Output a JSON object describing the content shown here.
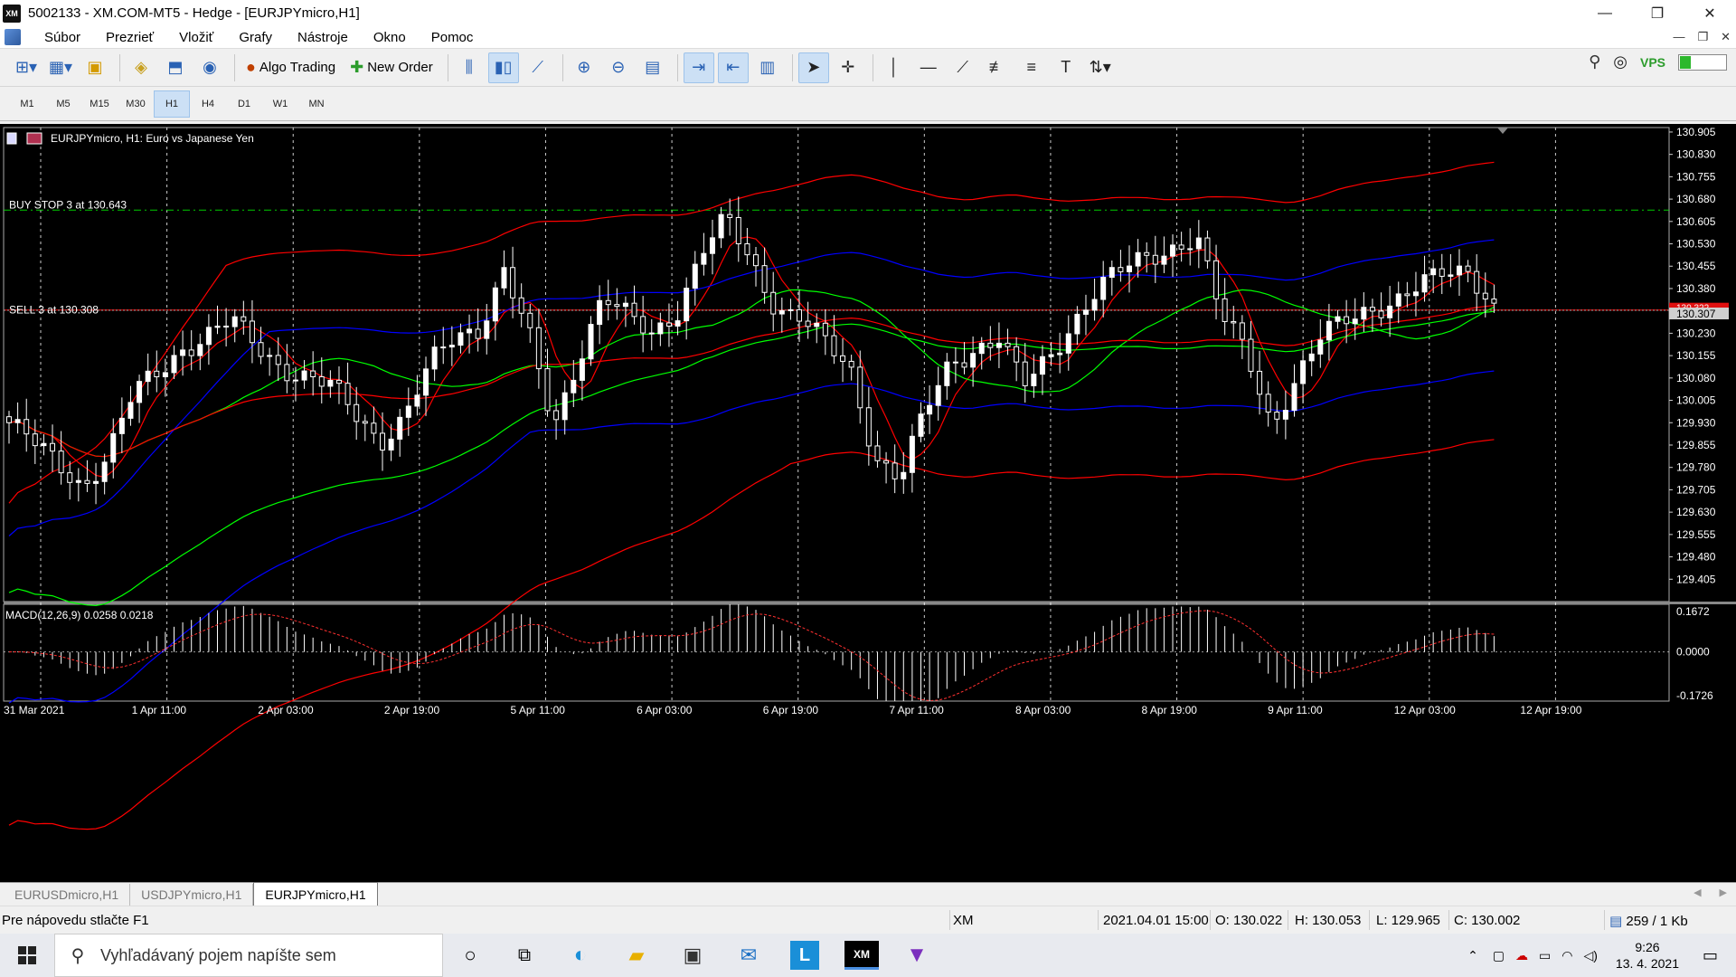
{
  "window": {
    "title": "5002133 - XM.COM-MT5 - Hedge - [EURJPYmicro,H1]",
    "logo_text": "XM",
    "controls": [
      "—",
      "❐",
      "✕"
    ]
  },
  "menu": {
    "items": [
      "Súbor",
      "Prezrieť",
      "Vložiť",
      "Grafy",
      "Nástroje",
      "Okno",
      "Pomoc"
    ],
    "mdi_controls": [
      "—",
      "❐",
      "✕"
    ]
  },
  "toolbar": {
    "algo_trading_label": "Algo Trading",
    "new_order_label": "New Order"
  },
  "timeframes": {
    "items": [
      "M1",
      "M5",
      "M15",
      "M30",
      "H1",
      "H4",
      "D1",
      "W1",
      "MN"
    ],
    "active": "H1"
  },
  "chart": {
    "header": "EURJPYmicro, H1:  Euro vs Japanese Yen",
    "buy_stop_label": "BUY STOP 3 at 130.643",
    "sell_label": "SELL 3 at 130.308",
    "bid_price": "130.307",
    "ask_price": "130.322",
    "macd_label": "MACD(12,26,9) 0.0258 0.0218",
    "price_ticks": [
      "130.905",
      "130.830",
      "130.755",
      "130.680",
      "130.605",
      "130.530",
      "130.455",
      "130.380",
      "130.230",
      "130.155",
      "130.080",
      "130.005",
      "129.930",
      "129.855",
      "129.780",
      "129.705",
      "129.630",
      "129.555",
      "129.480",
      "129.405"
    ],
    "macd_ticks": [
      "0.1672",
      "0.0000",
      "-0.1726"
    ],
    "time_ticks": [
      "31 Mar 2021",
      "1 Apr 11:00",
      "2 Apr 03:00",
      "2 Apr 19:00",
      "5 Apr 11:00",
      "6 Apr 03:00",
      "6 Apr 19:00",
      "7 Apr 11:00",
      "8 Apr 03:00",
      "8 Apr 19:00",
      "9 Apr 11:00",
      "12 Apr 03:00",
      "12 Apr 19:00"
    ],
    "colors": {
      "candle": "#ffffff",
      "ma_fast": "#ff0000",
      "ma_slow": "#00ff00",
      "bands_outer": "#ff0000",
      "bands_mid": "#0000ff",
      "order_line": "#ff0000",
      "pending_line": "#00ff00"
    }
  },
  "chart_data": {
    "type": "candlestick",
    "symbol": "EURJPYmicro",
    "timeframe": "H1",
    "ylim": [
      129.33,
      130.92
    ],
    "x_range": [
      "31 Mar 2021",
      "13 Apr 2021"
    ],
    "orders": [
      {
        "label": "BUY STOP 3 at 130.643",
        "price": 130.643
      },
      {
        "label": "SELL 3 at 130.308",
        "price": 130.308
      }
    ],
    "current_bid": 130.307,
    "current_ask": 130.322,
    "macd": {
      "params": "12,26,9",
      "main": 0.0258,
      "signal": 0.0218,
      "ylim": [
        -0.1726,
        0.1672
      ]
    },
    "close_path": [
      129.93,
      129.86,
      129.79,
      129.72,
      129.82,
      130.02,
      130.1,
      130.18,
      130.22,
      130.27,
      130.19,
      130.12,
      130.08,
      130.05,
      129.96,
      129.87,
      129.95,
      130.12,
      130.22,
      130.25,
      130.44,
      130.22,
      129.91,
      130.15,
      130.36,
      130.28,
      130.22,
      130.31,
      130.51,
      130.61,
      130.46,
      130.32,
      130.29,
      130.19,
      130.1,
      129.82,
      129.75,
      129.96,
      130.12,
      130.18,
      130.22,
      130.05,
      130.14,
      130.27,
      130.39,
      130.44,
      130.48,
      130.52,
      130.56,
      130.28,
      130.17,
      129.93,
      130.07,
      130.21,
      130.28,
      130.32,
      130.33,
      130.38,
      130.44,
      130.45,
      130.31
    ]
  },
  "chart_tabs": {
    "items": [
      "EURUSDmicro,H1",
      "USDJPYmicro,H1",
      "EURJPYmicro,H1"
    ],
    "active": "EURJPYmicro,H1"
  },
  "status": {
    "help": "Pre nápovedu stlačte F1",
    "profile": "XM",
    "datetime": "2021.04.01 15:00",
    "open": "O: 130.022",
    "high": "H: 130.053",
    "low": "L: 129.965",
    "close": "C: 130.002",
    "traffic": "259 / 1 Kb"
  },
  "taskbar": {
    "search_placeholder": "Vyhľadávaný pojem napíšte sem",
    "time": "9:26",
    "date": "13. 4. 2021"
  }
}
